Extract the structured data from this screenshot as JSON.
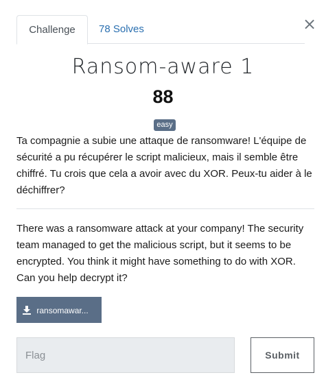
{
  "tabs": [
    {
      "label": "Challenge",
      "active": true
    },
    {
      "label": "78 Solves",
      "active": false
    }
  ],
  "close_symbol": "×",
  "challenge": {
    "name": "Ransom-aware 1",
    "points": "88",
    "difficulty": "easy",
    "description_fr": "Ta compagnie a subie une attaque de ransomware! L'équipe de sécurité a pu récupérer le script malicieux, mais il semble être chiffré. Tu crois que cela a avoir avec du XOR. Peux-tu aider à le déchiffrer?",
    "description_en": "There was a ransomware attack at your company! The security team managed to get the malicious script, but it seems to be encrypted. You think it might have something to do with XOR. Can you help decrypt it?",
    "file_label": "ransomawar..."
  },
  "form": {
    "flag_placeholder": "Flag",
    "submit_label": "Submit"
  },
  "colors": {
    "accent": "#5a6e87",
    "link": "#2a6fb0"
  },
  "icons": {
    "close": "close-icon",
    "download": "download-icon"
  }
}
